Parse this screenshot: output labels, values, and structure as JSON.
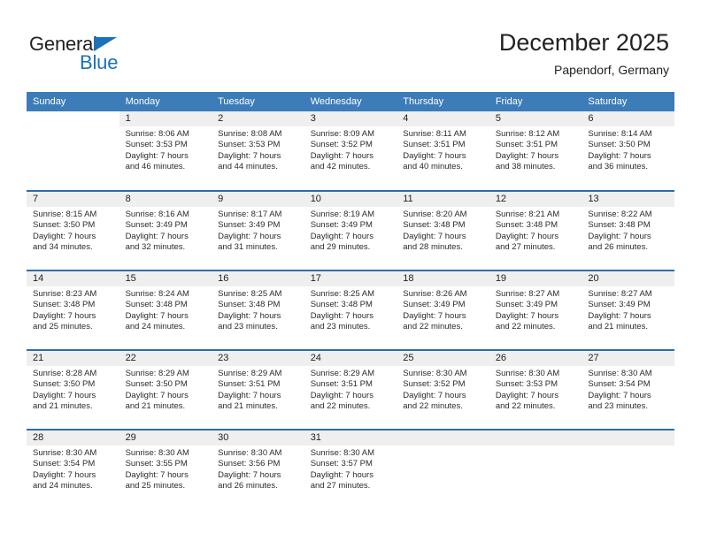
{
  "brand": {
    "name_part1": "General",
    "name_part2": "Blue",
    "triangle_icon": "triangle-icon",
    "accent_color": "#1a72b8"
  },
  "header": {
    "title": "December 2025",
    "subtitle": "Papendorf, Germany"
  },
  "colors": {
    "header_row_background": "#3c7cb8",
    "week_divider": "#2f6ea8",
    "date_band_background": "#efefef",
    "text": "#222222"
  },
  "calendar": {
    "day_names": [
      "Sunday",
      "Monday",
      "Tuesday",
      "Wednesday",
      "Thursday",
      "Friday",
      "Saturday"
    ],
    "weeks": [
      [
        {
          "date": "",
          "lines": []
        },
        {
          "date": "1",
          "lines": [
            "Sunrise: 8:06 AM",
            "Sunset: 3:53 PM",
            "Daylight: 7 hours",
            "and 46 minutes."
          ]
        },
        {
          "date": "2",
          "lines": [
            "Sunrise: 8:08 AM",
            "Sunset: 3:53 PM",
            "Daylight: 7 hours",
            "and 44 minutes."
          ]
        },
        {
          "date": "3",
          "lines": [
            "Sunrise: 8:09 AM",
            "Sunset: 3:52 PM",
            "Daylight: 7 hours",
            "and 42 minutes."
          ]
        },
        {
          "date": "4",
          "lines": [
            "Sunrise: 8:11 AM",
            "Sunset: 3:51 PM",
            "Daylight: 7 hours",
            "and 40 minutes."
          ]
        },
        {
          "date": "5",
          "lines": [
            "Sunrise: 8:12 AM",
            "Sunset: 3:51 PM",
            "Daylight: 7 hours",
            "and 38 minutes."
          ]
        },
        {
          "date": "6",
          "lines": [
            "Sunrise: 8:14 AM",
            "Sunset: 3:50 PM",
            "Daylight: 7 hours",
            "and 36 minutes."
          ]
        }
      ],
      [
        {
          "date": "7",
          "lines": [
            "Sunrise: 8:15 AM",
            "Sunset: 3:50 PM",
            "Daylight: 7 hours",
            "and 34 minutes."
          ]
        },
        {
          "date": "8",
          "lines": [
            "Sunrise: 8:16 AM",
            "Sunset: 3:49 PM",
            "Daylight: 7 hours",
            "and 32 minutes."
          ]
        },
        {
          "date": "9",
          "lines": [
            "Sunrise: 8:17 AM",
            "Sunset: 3:49 PM",
            "Daylight: 7 hours",
            "and 31 minutes."
          ]
        },
        {
          "date": "10",
          "lines": [
            "Sunrise: 8:19 AM",
            "Sunset: 3:49 PM",
            "Daylight: 7 hours",
            "and 29 minutes."
          ]
        },
        {
          "date": "11",
          "lines": [
            "Sunrise: 8:20 AM",
            "Sunset: 3:48 PM",
            "Daylight: 7 hours",
            "and 28 minutes."
          ]
        },
        {
          "date": "12",
          "lines": [
            "Sunrise: 8:21 AM",
            "Sunset: 3:48 PM",
            "Daylight: 7 hours",
            "and 27 minutes."
          ]
        },
        {
          "date": "13",
          "lines": [
            "Sunrise: 8:22 AM",
            "Sunset: 3:48 PM",
            "Daylight: 7 hours",
            "and 26 minutes."
          ]
        }
      ],
      [
        {
          "date": "14",
          "lines": [
            "Sunrise: 8:23 AM",
            "Sunset: 3:48 PM",
            "Daylight: 7 hours",
            "and 25 minutes."
          ]
        },
        {
          "date": "15",
          "lines": [
            "Sunrise: 8:24 AM",
            "Sunset: 3:48 PM",
            "Daylight: 7 hours",
            "and 24 minutes."
          ]
        },
        {
          "date": "16",
          "lines": [
            "Sunrise: 8:25 AM",
            "Sunset: 3:48 PM",
            "Daylight: 7 hours",
            "and 23 minutes."
          ]
        },
        {
          "date": "17",
          "lines": [
            "Sunrise: 8:25 AM",
            "Sunset: 3:48 PM",
            "Daylight: 7 hours",
            "and 23 minutes."
          ]
        },
        {
          "date": "18",
          "lines": [
            "Sunrise: 8:26 AM",
            "Sunset: 3:49 PM",
            "Daylight: 7 hours",
            "and 22 minutes."
          ]
        },
        {
          "date": "19",
          "lines": [
            "Sunrise: 8:27 AM",
            "Sunset: 3:49 PM",
            "Daylight: 7 hours",
            "and 22 minutes."
          ]
        },
        {
          "date": "20",
          "lines": [
            "Sunrise: 8:27 AM",
            "Sunset: 3:49 PM",
            "Daylight: 7 hours",
            "and 21 minutes."
          ]
        }
      ],
      [
        {
          "date": "21",
          "lines": [
            "Sunrise: 8:28 AM",
            "Sunset: 3:50 PM",
            "Daylight: 7 hours",
            "and 21 minutes."
          ]
        },
        {
          "date": "22",
          "lines": [
            "Sunrise: 8:29 AM",
            "Sunset: 3:50 PM",
            "Daylight: 7 hours",
            "and 21 minutes."
          ]
        },
        {
          "date": "23",
          "lines": [
            "Sunrise: 8:29 AM",
            "Sunset: 3:51 PM",
            "Daylight: 7 hours",
            "and 21 minutes."
          ]
        },
        {
          "date": "24",
          "lines": [
            "Sunrise: 8:29 AM",
            "Sunset: 3:51 PM",
            "Daylight: 7 hours",
            "and 22 minutes."
          ]
        },
        {
          "date": "25",
          "lines": [
            "Sunrise: 8:30 AM",
            "Sunset: 3:52 PM",
            "Daylight: 7 hours",
            "and 22 minutes."
          ]
        },
        {
          "date": "26",
          "lines": [
            "Sunrise: 8:30 AM",
            "Sunset: 3:53 PM",
            "Daylight: 7 hours",
            "and 22 minutes."
          ]
        },
        {
          "date": "27",
          "lines": [
            "Sunrise: 8:30 AM",
            "Sunset: 3:54 PM",
            "Daylight: 7 hours",
            "and 23 minutes."
          ]
        }
      ],
      [
        {
          "date": "28",
          "lines": [
            "Sunrise: 8:30 AM",
            "Sunset: 3:54 PM",
            "Daylight: 7 hours",
            "and 24 minutes."
          ]
        },
        {
          "date": "29",
          "lines": [
            "Sunrise: 8:30 AM",
            "Sunset: 3:55 PM",
            "Daylight: 7 hours",
            "and 25 minutes."
          ]
        },
        {
          "date": "30",
          "lines": [
            "Sunrise: 8:30 AM",
            "Sunset: 3:56 PM",
            "Daylight: 7 hours",
            "and 26 minutes."
          ]
        },
        {
          "date": "31",
          "lines": [
            "Sunrise: 8:30 AM",
            "Sunset: 3:57 PM",
            "Daylight: 7 hours",
            "and 27 minutes."
          ]
        },
        {
          "date": "",
          "lines": []
        },
        {
          "date": "",
          "lines": []
        },
        {
          "date": "",
          "lines": []
        }
      ]
    ]
  }
}
